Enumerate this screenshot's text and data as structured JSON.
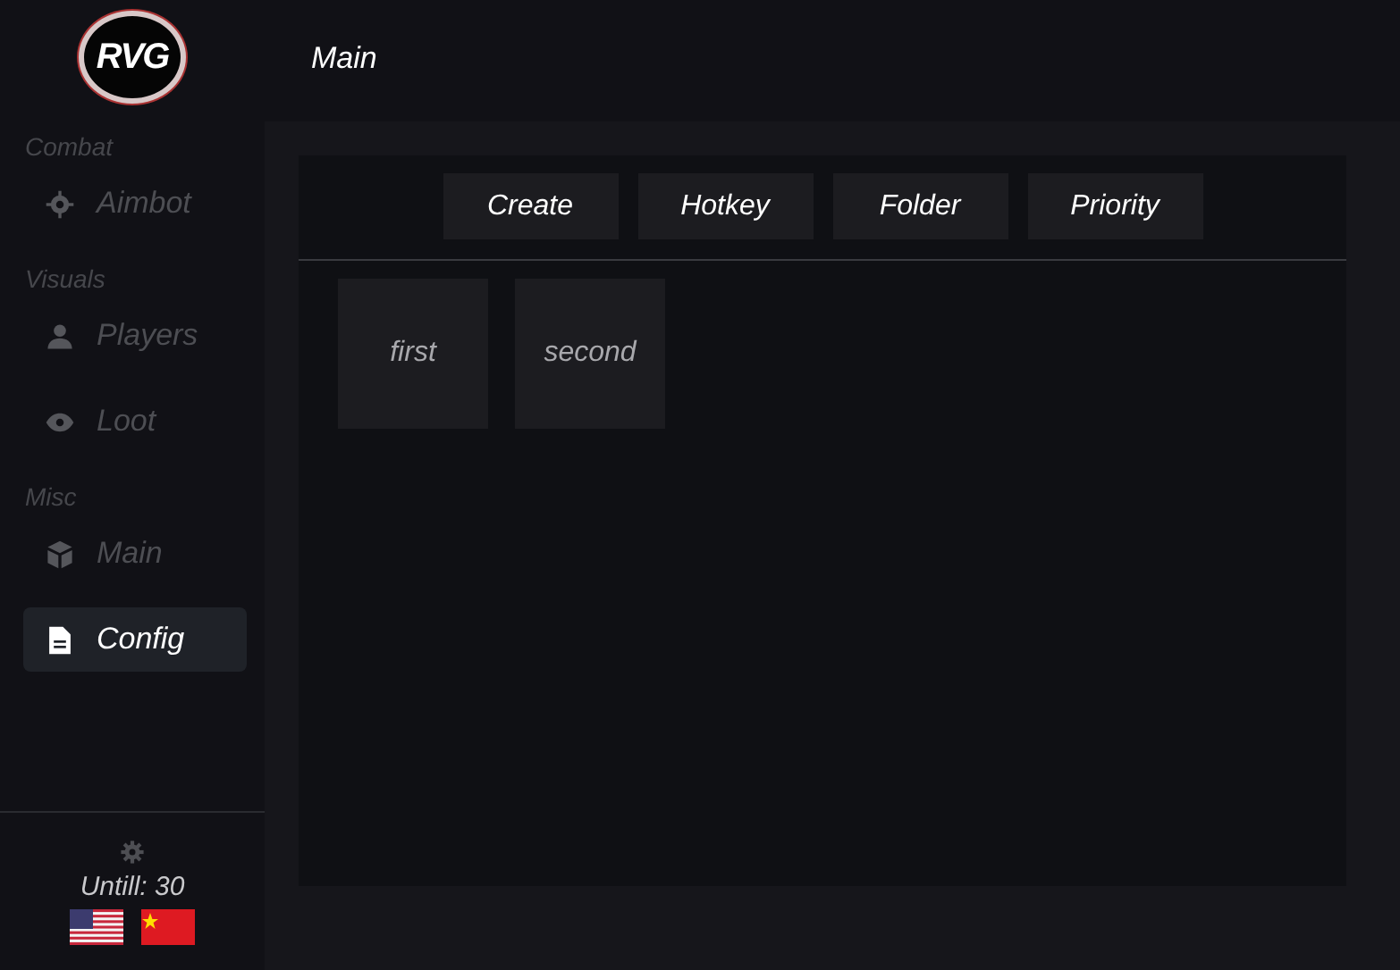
{
  "logo": {
    "text": "RVG"
  },
  "header": {
    "title": "Main"
  },
  "sidebar": {
    "sections": [
      {
        "title": "Combat",
        "items": [
          {
            "label": "Aimbot",
            "kind": "crosshair",
            "selected": false
          }
        ]
      },
      {
        "title": "Visuals",
        "items": [
          {
            "label": "Players",
            "kind": "person",
            "selected": false
          },
          {
            "label": "Loot",
            "kind": "eye",
            "selected": false
          }
        ]
      },
      {
        "title": "Misc",
        "items": [
          {
            "label": "Main",
            "kind": "cube",
            "selected": false
          },
          {
            "label": "Config",
            "kind": "document",
            "selected": true
          }
        ]
      }
    ],
    "footer": {
      "expiry": "Untill: 30",
      "flags": [
        {
          "kind": "us"
        },
        {
          "kind": "cn"
        }
      ]
    }
  },
  "toolbar": {
    "buttons": [
      "Create",
      "Hotkey",
      "Folder",
      "Priority"
    ]
  },
  "configs": [
    {
      "label": "first"
    },
    {
      "label": "second"
    }
  ]
}
